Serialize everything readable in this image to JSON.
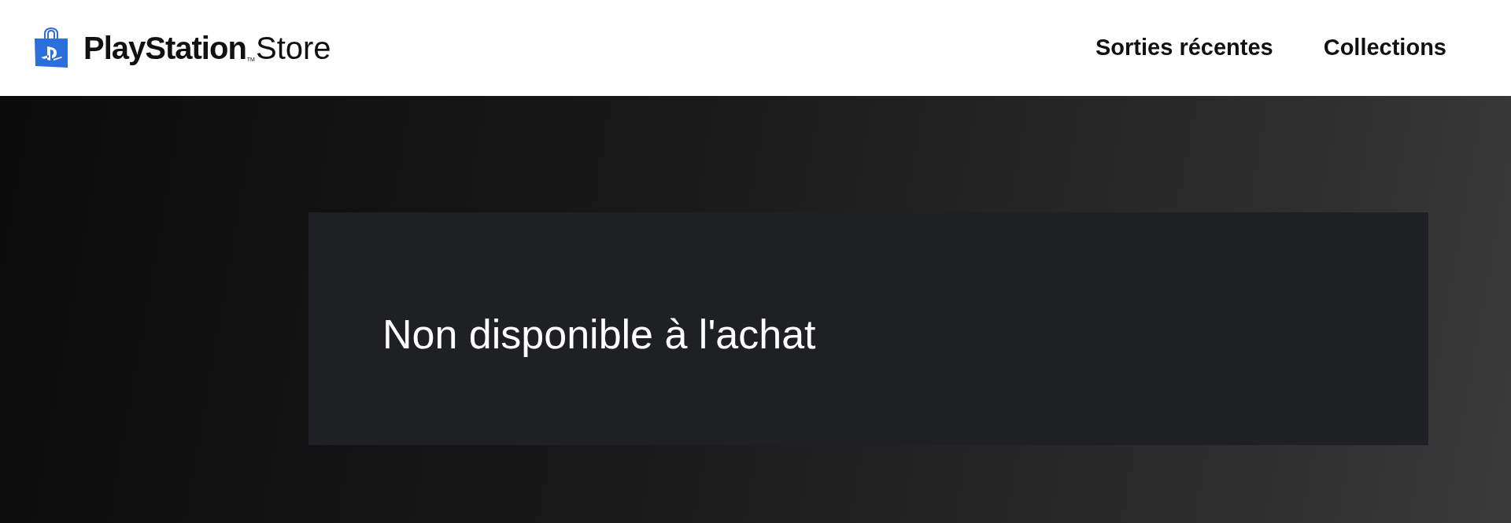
{
  "header": {
    "logo": {
      "brand": "PlayStation",
      "trademark": "TM",
      "product": "Store"
    },
    "nav": [
      {
        "label": "Sorties récentes"
      },
      {
        "label": "Collections"
      }
    ]
  },
  "availability": {
    "message": "Non disponible à l'achat"
  }
}
